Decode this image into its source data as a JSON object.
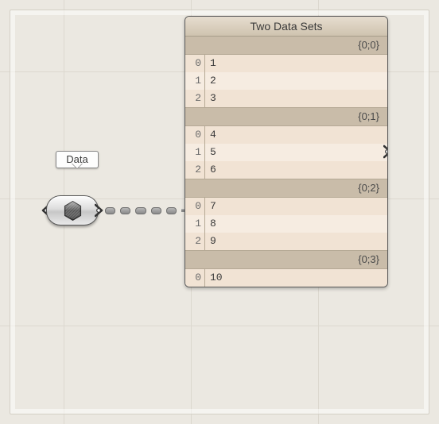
{
  "tooltip_label": "Data",
  "panel": {
    "title": "Two Data Sets",
    "branches": [
      {
        "path": "{0;0}",
        "items": [
          "1",
          "2",
          "3"
        ]
      },
      {
        "path": "{0;1}",
        "items": [
          "4",
          "5",
          "6"
        ]
      },
      {
        "path": "{0;2}",
        "items": [
          "7",
          "8",
          "9"
        ]
      },
      {
        "path": "{0;3}",
        "items": [
          "10"
        ]
      }
    ]
  }
}
